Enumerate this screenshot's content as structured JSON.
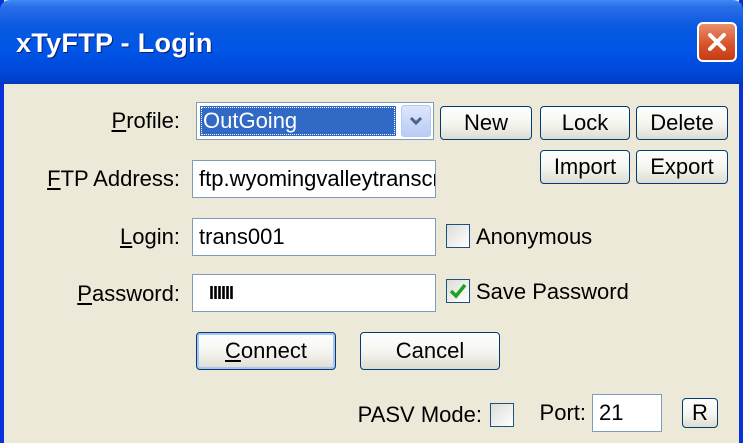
{
  "window": {
    "title": "xTyFTP - Login"
  },
  "profile": {
    "label_prefix": "",
    "label_u": "P",
    "label_rest": "rofile:",
    "selected": "OutGoing"
  },
  "buttons": {
    "new": "New",
    "lock": "Lock",
    "delete": "Delete",
    "import": "Import",
    "export": "Export",
    "connect_u": "C",
    "connect_rest": "onnect",
    "cancel": "Cancel",
    "reset": "R"
  },
  "ftp": {
    "label_u": "F",
    "label_rest": "TP Address:",
    "value": "ftp.wyomingvalleytranscr"
  },
  "login": {
    "label_u": "L",
    "label_rest": "ogin:",
    "value": "trans001"
  },
  "password": {
    "label_u": "P",
    "label_rest": "assword:",
    "value": "IIIIII"
  },
  "anonymous": {
    "label": "Anonymous",
    "checked": false
  },
  "save_password": {
    "label": "Save Password",
    "checked": true
  },
  "pasv": {
    "label": "PASV Mode:",
    "checked": false
  },
  "port": {
    "label": "Port:",
    "value": "21"
  },
  "colors": {
    "titlebar": "#0055e6",
    "selection": "#316ac5",
    "close": "#d9542b",
    "check": "#21a121"
  }
}
